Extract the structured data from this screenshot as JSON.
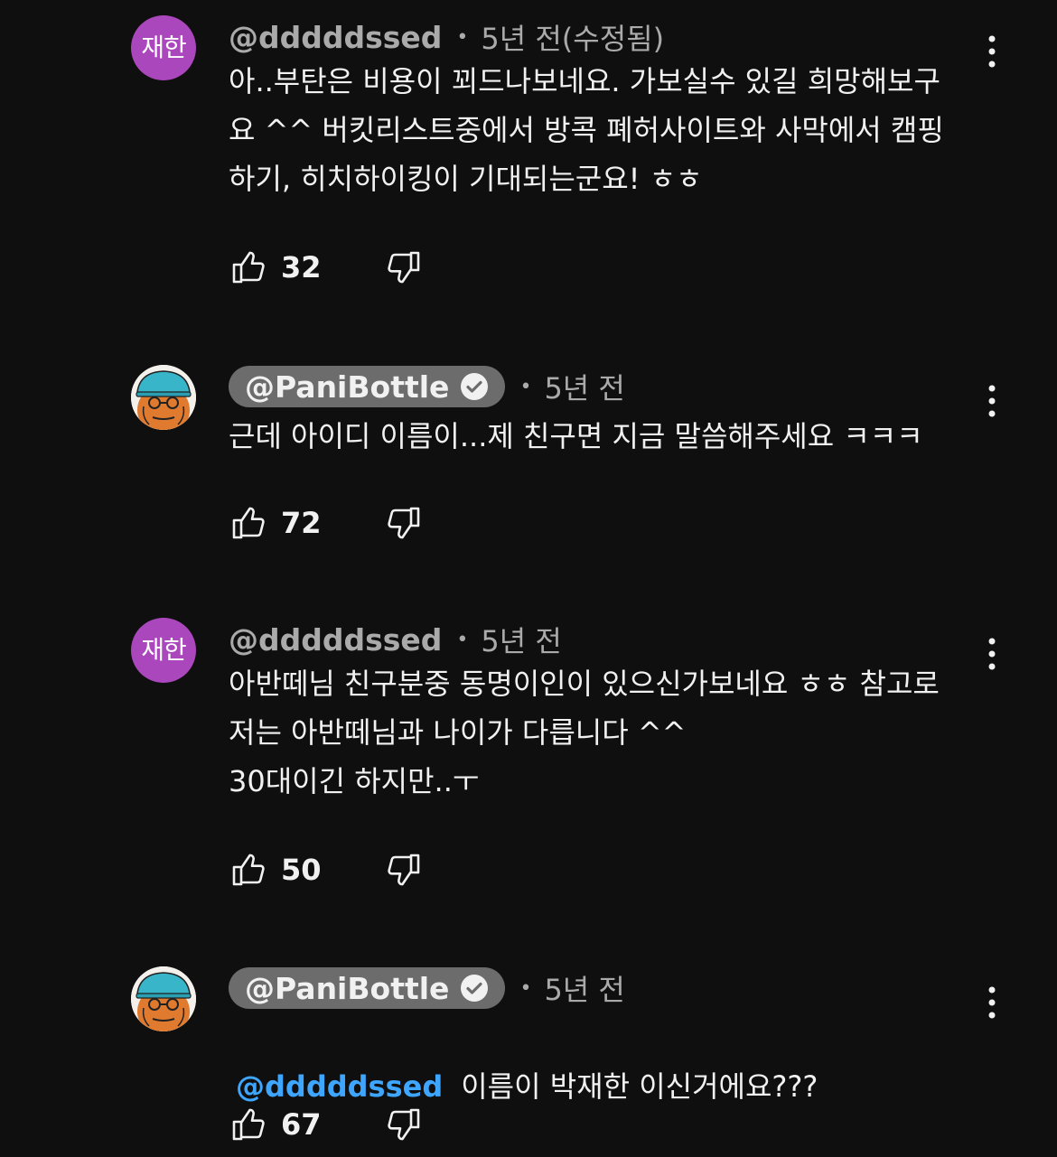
{
  "comments": [
    {
      "avatar_initials": "재한",
      "author": "@dddddssed",
      "time": "5년 전(수정됨)",
      "text": "아..부탄은 비용이 꾀드나보네요. 가보실수 있길 희망해보구\n요 ^^ 버킷리스트중에서 방콕 폐허사이트와 사막에서 캠핑\n하기, 히치하이킹이 기대되는군요! ㅎㅎ",
      "likes": "32"
    },
    {
      "author": "@PaniBottle",
      "time": "5년 전",
      "text": "근데 아이디 이름이...제 친구면 지금 말씀해주세요 ㅋㅋㅋ",
      "likes": "72"
    },
    {
      "avatar_initials": "재한",
      "author": "@dddddssed",
      "time": "5년 전",
      "text": "아반떼님 친구분중 동명이인이 있으신가보네요 ㅎㅎ 참고로\n저는 아반떼님과 나이가 다릅니다 ^^\n30대이긴 하지만..ㅜ",
      "likes": "50"
    },
    {
      "author": "@PaniBottle",
      "time": "5년 전",
      "mention": "@dddddssed",
      "text": "이름이 박재한 이신거에요???",
      "likes": "67"
    }
  ],
  "icons": {
    "like": "thumbs-up-icon",
    "dislike": "thumbs-down-icon",
    "menu": "more-vertical-icon",
    "verified": "verified-check-icon"
  },
  "colors": {
    "background": "#0f0f0f",
    "avatar_purple": "#ab47bc",
    "mention_blue": "#3ea6ff",
    "author_chip": "#6c6c6c"
  }
}
